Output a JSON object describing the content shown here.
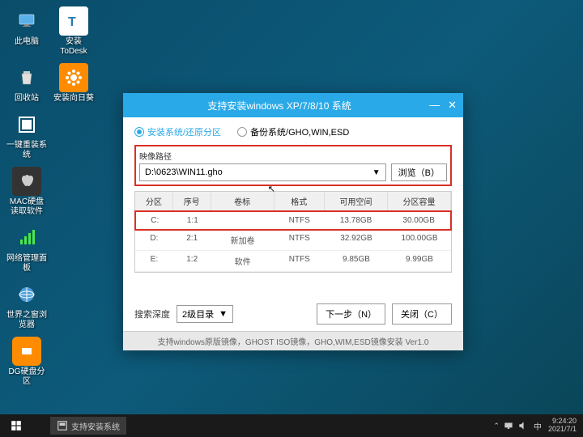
{
  "desktop": {
    "icons": [
      {
        "label": "此电脑",
        "name": "this-pc"
      },
      {
        "label": "安装ToDesk",
        "name": "install-todesk"
      },
      {
        "label": "回收站",
        "name": "recycle-bin"
      },
      {
        "label": "安装向日葵",
        "name": "install-sunflower"
      },
      {
        "label": "一键重装系统",
        "name": "one-click-reinstall"
      },
      {
        "label": "MAC硬盘读取软件",
        "name": "mac-disk-reader"
      },
      {
        "label": "网络管理面板",
        "name": "network-panel"
      },
      {
        "label": "世界之窗浏览器",
        "name": "world-browser"
      },
      {
        "label": "DG硬盘分区",
        "name": "dg-partition"
      }
    ]
  },
  "installer": {
    "title": "支持安装windows XP/7/8/10 系统",
    "radio_install": "安装系统/还原分区",
    "radio_backup": "备份系统/GHO,WIN,ESD",
    "path_label": "映像路径",
    "path_value": "D:\\0623\\WIN11.gho",
    "browse_btn": "浏览（B）",
    "table": {
      "headers": [
        "分区",
        "序号",
        "卷标",
        "格式",
        "可用空间",
        "分区容量"
      ],
      "rows": [
        {
          "drive": "C:",
          "index": "1:1",
          "label": "",
          "fs": "NTFS",
          "free": "13.78GB",
          "total": "30.00GB",
          "highlighted": true
        },
        {
          "drive": "D:",
          "index": "2:1",
          "label": "新加卷",
          "fs": "NTFS",
          "free": "32.92GB",
          "total": "100.00GB",
          "highlighted": false
        },
        {
          "drive": "E:",
          "index": "1:2",
          "label": "软件",
          "fs": "NTFS",
          "free": "9.85GB",
          "total": "9.99GB",
          "highlighted": false
        }
      ]
    },
    "depth_label": "搜索深度",
    "depth_value": "2级目录",
    "next_btn": "下一步（N）",
    "close_btn": "关闭（C）",
    "footer": "支持windows原版镜像，GHOST ISO镜像，GHO,WIM,ESD镜像安装 Ver1.0"
  },
  "taskbar": {
    "task_label": "支持安装系统",
    "time": "9:24:20",
    "date": "2021/7/1"
  }
}
